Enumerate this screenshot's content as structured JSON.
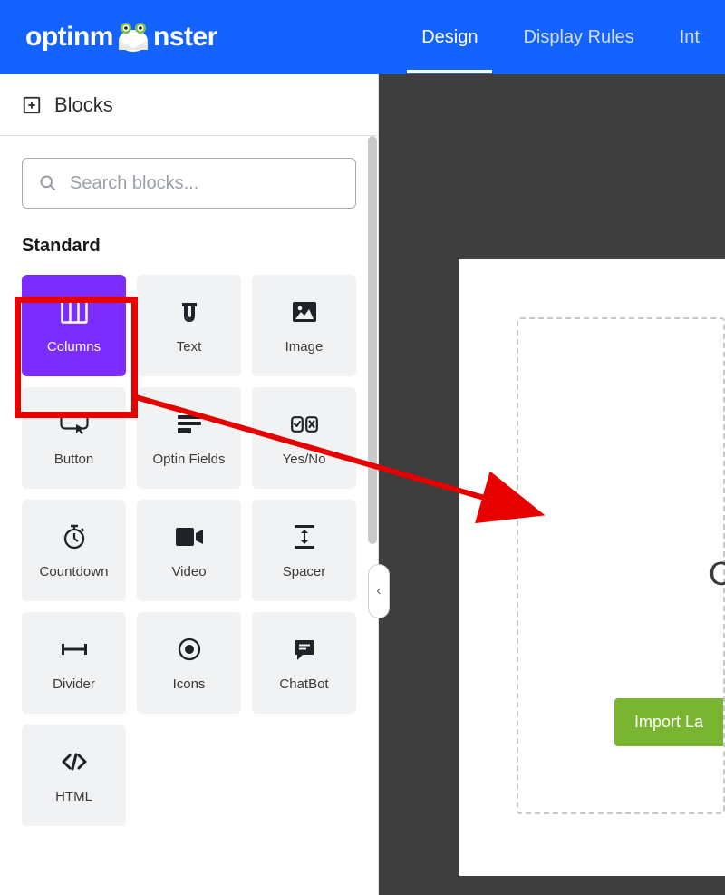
{
  "header": {
    "brand_prefix": "optinm",
    "brand_suffix": "nster",
    "nav": {
      "design": "Design",
      "display_rules": "Display Rules",
      "integrations": "Int"
    }
  },
  "sidebar": {
    "title": "Blocks",
    "search_placeholder": "Search blocks...",
    "section_standard": "Standard",
    "blocks": {
      "columns": "Columns",
      "text": "Text",
      "image": "Image",
      "button": "Button",
      "optin_fields": "Optin Fields",
      "yesno": "Yes/No",
      "countdown": "Countdown",
      "video": "Video",
      "spacer": "Spacer",
      "divider": "Divider",
      "icons": "Icons",
      "chatbot": "ChatBot",
      "html": "HTML"
    }
  },
  "canvas": {
    "drop_letter": "C",
    "import_button": "Import La"
  }
}
